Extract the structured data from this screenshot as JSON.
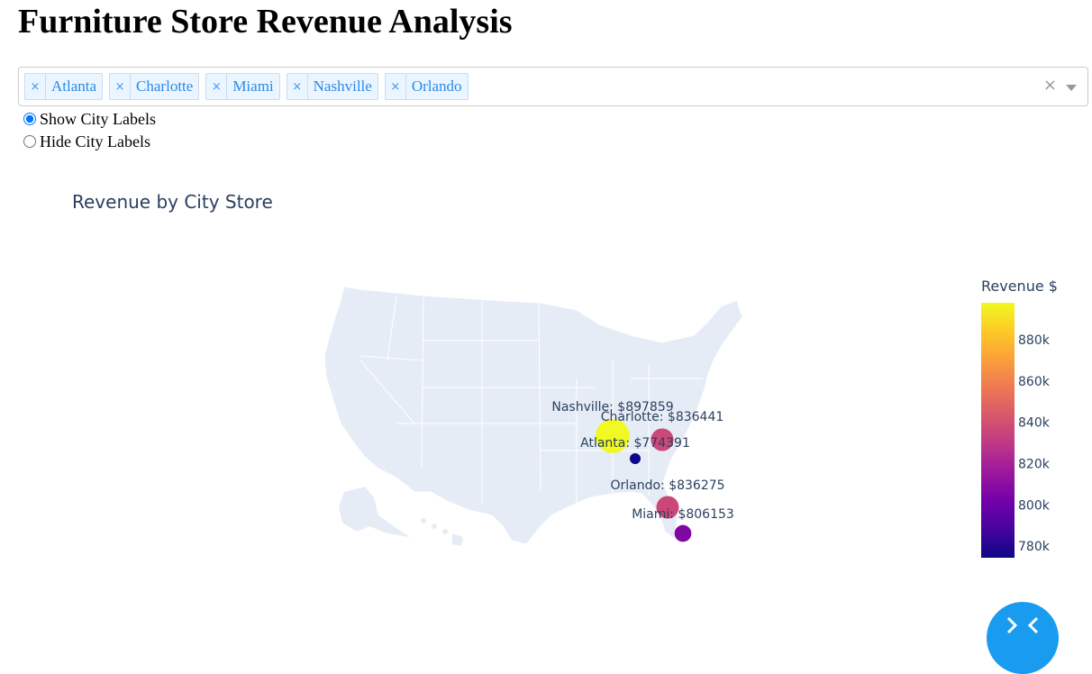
{
  "page": {
    "title": "Furniture Store Revenue Analysis"
  },
  "city_filter": {
    "selected": [
      "Atlanta",
      "Charlotte",
      "Miami",
      "Nashville",
      "Orlando"
    ],
    "remove_glyph": "×",
    "clear_glyph": "×"
  },
  "label_toggle": {
    "options": [
      "Show City Labels",
      "Hide City Labels"
    ],
    "selected": "Show City Labels"
  },
  "colors": {
    "map_land": "#e5ecf6",
    "map_border": "#ffffff",
    "accent": "#199cf0",
    "text": "#2a3f5f"
  },
  "chart_data": {
    "type": "scatter",
    "map": "usa",
    "title": "Revenue by City Store",
    "x": [
      "Atlanta",
      "Charlotte",
      "Miami",
      "Nashville",
      "Orlando"
    ],
    "points": [
      {
        "city": "Atlanta",
        "value": 774391,
        "label": "Atlanta: $774391",
        "lat": 33.75,
        "lon": -84.39
      },
      {
        "city": "Charlotte",
        "value": 836441,
        "label": "Charlotte: $836441",
        "lat": 35.23,
        "lon": -80.84
      },
      {
        "city": "Miami",
        "value": 806153,
        "label": "Miami: $806153",
        "lat": 25.76,
        "lon": -80.19
      },
      {
        "city": "Nashville",
        "value": 897859,
        "label": "Nashville: $897859",
        "lat": 36.16,
        "lon": -86.78
      },
      {
        "city": "Orlando",
        "value": 836275,
        "label": "Orlando: $836275",
        "lat": 28.54,
        "lon": -81.38
      }
    ],
    "colorbar": {
      "title": "Revenue $",
      "ticks": [
        "780k",
        "800k",
        "820k",
        "840k",
        "860k",
        "880k"
      ],
      "tick_values": [
        780000,
        800000,
        820000,
        840000,
        860000,
        880000
      ],
      "range": [
        774391,
        897859
      ],
      "colorscale": "plasma"
    },
    "legend": "colorbar-right"
  }
}
